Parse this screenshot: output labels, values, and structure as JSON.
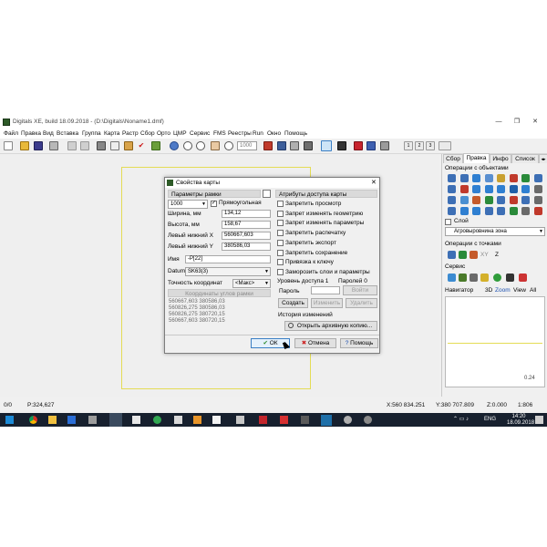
{
  "window": {
    "title": "Digitals XE, build 18.09.2018 - (D:\\Digitals\\Noname1.dmf)",
    "controls": [
      "—",
      "❐",
      "✕"
    ]
  },
  "menu": [
    "Файл",
    "Правка",
    "Вид",
    "Вставка",
    "Группа",
    "Карта",
    "Растр",
    "Сбор",
    "Орто",
    "ЦМР",
    "Сервис",
    "FMS",
    "Реестры",
    "Run",
    "Окно",
    "Помощь"
  ],
  "toolbar": {
    "scale_value": "1000",
    "page_buttons": [
      "1",
      "2",
      "3"
    ]
  },
  "status": {
    "left_count": "0/0",
    "position": "Р:324,627",
    "x": "X:560 834.251",
    "y": "Y:380 707.809",
    "z": "Z:0.000",
    "scale": "1:806"
  },
  "right_panel": {
    "tabs": [
      "Сбор",
      "Правка",
      "Инфо",
      "Список"
    ],
    "active_tab": "Правка",
    "objects_title": "Операции с объектами",
    "layer_label": "Слой",
    "layer_value": "Агровыровнина зона",
    "points_title": "Операции с точками",
    "points_xy": "XY",
    "points_z": "Z",
    "service_title": "Сервис",
    "navigator_title": "Навигатор",
    "navigator_tabs": [
      "3D",
      "Zoom",
      "View",
      "All"
    ],
    "navigator_value": "0.24"
  },
  "dialog": {
    "title": "Свойства карты",
    "frame_params_title": "Параметры рамки",
    "frame_scale": "1000",
    "rect_checkbox_label": "Прямоугольная",
    "width_label": "Ширина, мм",
    "width_value": "134,12",
    "height_label": "Высота, мм",
    "height_value": "158,67",
    "left_x_label": "Левый нижний X",
    "left_x_value": "560667,603",
    "left_y_label": "Левый нижний Y",
    "left_y_value": "380586,03",
    "name_label": "Имя",
    "name_value": "-P[22]",
    "datum_label": "Datum",
    "datum_value": "SK63(3)",
    "precision_label": "Точность координат",
    "precision_value": "<Макс>",
    "corners_button": "Координаты углов рамки",
    "corners": [
      "560667,603 380586,03",
      "560826,275 380586,03",
      "560826,275 380720,15",
      "560667,603 380720,15"
    ],
    "access_title": "Атрибуты доступа карты",
    "access_checks": [
      "Запретить просмотр",
      "Запрет изменять геометрию",
      "Запрет изменять параметры",
      "Запретить распечатку",
      "Запретить экспорт",
      "Запретить сохранение",
      "Привязка к ключу",
      "Заморозить слои и параметры"
    ],
    "access_level": "Уровень доступа 1",
    "passwords": "Паролей 0",
    "password_label": "Пароль",
    "enter_button": "Войти",
    "create_button": "Создать",
    "change_button": "Изменить",
    "delete_button": "Удалить",
    "history_title": "История изменений",
    "archive_button": "Открыть архивную копию...",
    "ok_button": "ОК",
    "cancel_button": "Отмена",
    "help_button": "Помощь"
  },
  "taskbar": {
    "lang": "ENG",
    "time": "14:20",
    "date": "18.09.2018"
  },
  "colors": {
    "frame_yellow": "#e4dc55",
    "taskbar": "#17202e",
    "app_green": "#2d5a27"
  }
}
